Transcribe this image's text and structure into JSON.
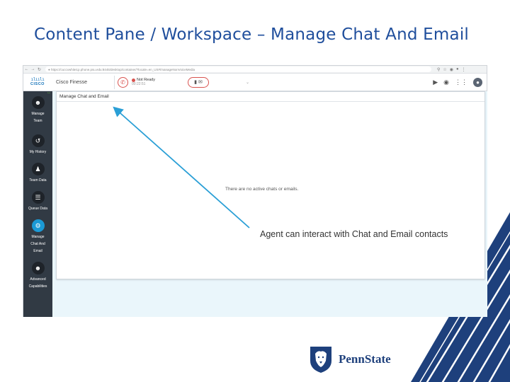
{
  "slide": {
    "title": "Content Pane / Workspace – Manage Chat And Email",
    "callout": "Agent can interact with Chat and Email contacts"
  },
  "browser": {
    "url": "https://cuccxwhite1p.phone.psu.edu:8445/desktop/container/?locale=en_US#/manageNonVoiceMedia"
  },
  "header": {
    "brand_word": "CISCO",
    "app_name": "Cisco Finesse",
    "state_label": "Not Ready",
    "state_time": "00:22:51"
  },
  "sidebar": {
    "items": [
      {
        "label": "Manage\nTeam",
        "icon": "manage-team-icon"
      },
      {
        "label": "My History",
        "icon": "history-icon"
      },
      {
        "label": "Team Data",
        "icon": "team-data-icon"
      },
      {
        "label": "Queue Data",
        "icon": "queue-data-icon"
      },
      {
        "label": "Manage\nChat And\nEmail",
        "icon": "gear-icon",
        "active": true
      },
      {
        "label": "Advanced\nCapabilities",
        "icon": "advanced-capabilities-icon"
      }
    ]
  },
  "panel": {
    "title": "Manage Chat and Email",
    "empty_message": "There are no active chats or emails."
  },
  "footer": {
    "brand": "PennState"
  },
  "colors": {
    "title_blue": "#1f4e9c",
    "arrow_blue": "#2a9fd6",
    "sidebar_dark": "#313a44",
    "active_blue": "#1b9ad6",
    "alert_red": "#d9534f",
    "penn_navy": "#1e407c"
  }
}
